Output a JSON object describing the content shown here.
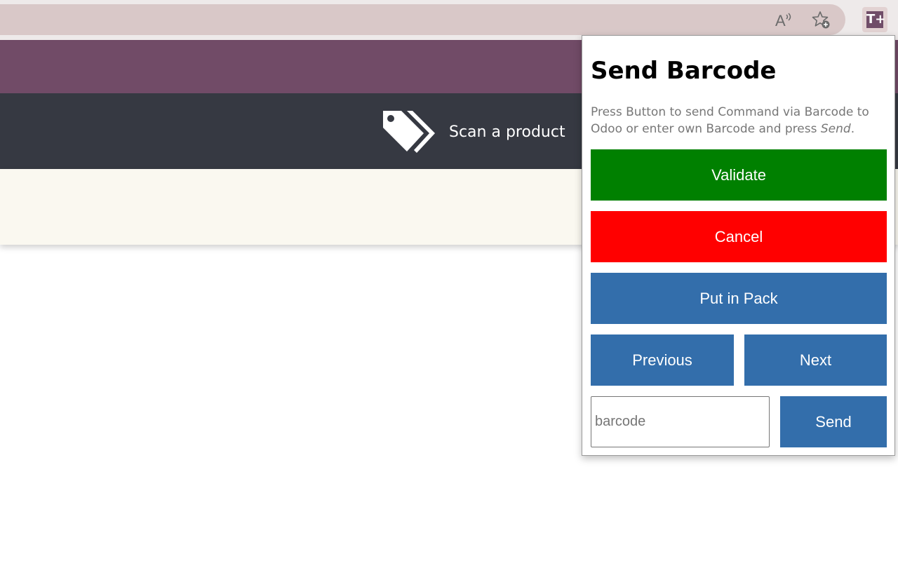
{
  "browser": {
    "icons": [
      "read-aloud-icon",
      "add-favorite-icon",
      "extension-icon"
    ],
    "extension_logo": "T+"
  },
  "page": {
    "scan_label": "Scan a product",
    "colors": {
      "nav": "#714b67",
      "scan_bar": "#363942",
      "cream": "#faf8f0"
    }
  },
  "popup": {
    "title": "Send Barcode",
    "description_text": "Press Button to send Command via Barcode to Odoo or enter own Barcode and press ",
    "description_em": "Send",
    "description_end": ".",
    "buttons": {
      "validate": {
        "label": "Validate",
        "color": "#008000"
      },
      "cancel": {
        "label": "Cancel",
        "color": "#ff0000"
      },
      "put_in_pack": {
        "label": "Put in Pack",
        "color": "#336eab"
      },
      "previous": {
        "label": "Previous",
        "color": "#336eab"
      },
      "next": {
        "label": "Next",
        "color": "#336eab"
      },
      "send": {
        "label": "Send",
        "color": "#336eab"
      }
    },
    "barcode_input": {
      "value": "",
      "placeholder": "barcode"
    }
  }
}
